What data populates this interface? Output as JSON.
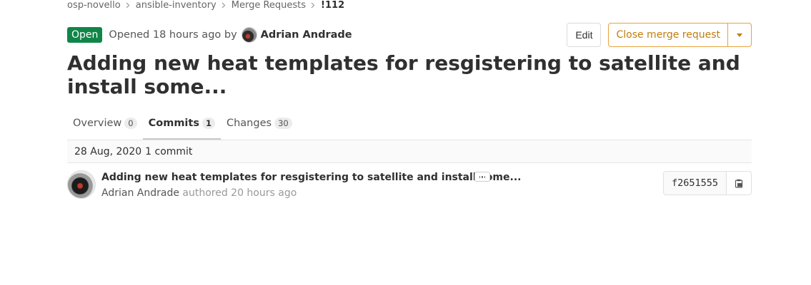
{
  "breadcrumb": {
    "items": [
      "osp-novello",
      "ansible-inventory",
      "Merge Requests",
      "!112"
    ]
  },
  "header": {
    "status_badge": "Open",
    "opened_text": "Opened 18 hours ago by",
    "author": "Adrian Andrade",
    "edit_label": "Edit",
    "close_label": "Close merge request"
  },
  "title": "Adding new heat templates for resgistering to satellite and install some...",
  "tabs": [
    {
      "label": "Overview",
      "count": "0"
    },
    {
      "label": "Commits",
      "count": "1"
    },
    {
      "label": "Changes",
      "count": "30"
    }
  ],
  "commits": {
    "date": "28 Aug, 2020",
    "count_text": "1 commit",
    "items": [
      {
        "title": "Adding new heat templates for resgistering to satellite and install some...",
        "author": "Adrian Andrade",
        "authored_text": "authored 20 hours ago",
        "sha": "f2651555"
      }
    ]
  },
  "colors": {
    "open_badge": "#108548",
    "close_accent": "#e9a23b"
  },
  "icons": {
    "breadcrumb_separator": "chevron-right-icon",
    "dropdown": "chevron-down-icon",
    "ellipsis": "ellipsis-icon",
    "copy": "clipboard-icon"
  }
}
